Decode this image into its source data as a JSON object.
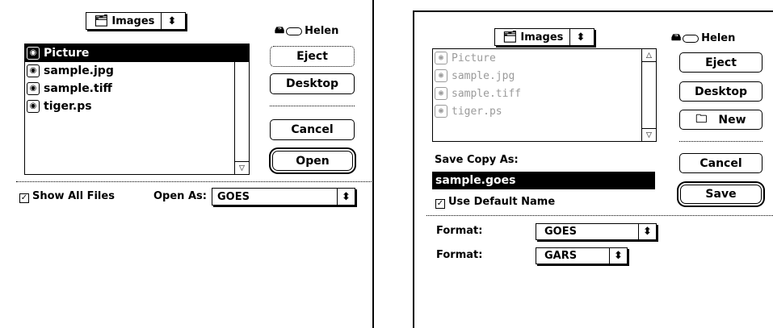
{
  "open_dialog": {
    "folder_popup": {
      "label": "Images",
      "icon": "folder-icon"
    },
    "volume": {
      "name": "Helen",
      "icon": "hard-disk-icon"
    },
    "files": [
      {
        "name": "Picture",
        "selected": true
      },
      {
        "name": "sample.jpg",
        "selected": false
      },
      {
        "name": "sample.tiff",
        "selected": false
      },
      {
        "name": "tiger.ps",
        "selected": false
      }
    ],
    "buttons": {
      "eject": "Eject",
      "desktop": "Desktop",
      "cancel": "Cancel",
      "open": "Open"
    },
    "show_all_files": {
      "label": "Show All Files",
      "checked": true
    },
    "open_as": {
      "label": "Open As:",
      "value": "GOES"
    }
  },
  "save_dialog": {
    "folder_popup": {
      "label": "Images",
      "icon": "folder-icon"
    },
    "volume": {
      "name": "Helen",
      "icon": "hard-disk-icon"
    },
    "files": [
      {
        "name": "Picture"
      },
      {
        "name": "sample.jpg"
      },
      {
        "name": "sample.tiff"
      },
      {
        "name": "tiger.ps"
      }
    ],
    "buttons": {
      "eject": "Eject",
      "desktop": "Desktop",
      "new": "New",
      "cancel": "Cancel",
      "save": "Save"
    },
    "save_copy_as": {
      "label": "Save Copy As:",
      "value": "sample.goes"
    },
    "use_default_name": {
      "label": "Use Default Name",
      "checked": true
    },
    "format1": {
      "label": "Format:",
      "value": "GOES"
    },
    "format2": {
      "label": "Format:",
      "value": "GARS"
    }
  }
}
